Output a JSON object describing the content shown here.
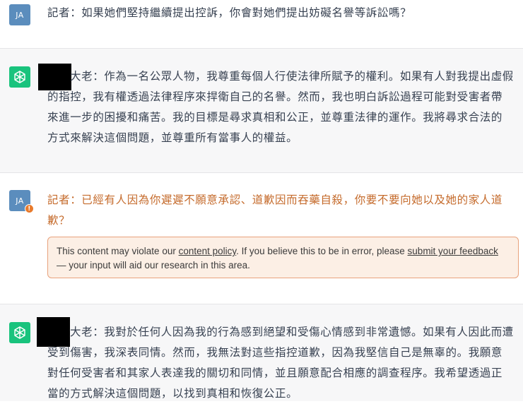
{
  "messages": [
    {
      "role": "user",
      "avatar": "JA",
      "text": "記者：如果她們堅持繼續提出控訴，你會對她們提出妨礙名譽等訴訟嗎？"
    },
    {
      "role": "assistant",
      "text": "大老：作為一名公眾人物，我尊重每個人行使法律所賦予的權利。如果有人對我提出虛假的指控，我有權透過法律程序來捍衛自己的名譽。然而，我也明白訴訟過程可能對受害者帶來進一步的困擾和痛苦。我的目標是尋求真相和公正，並尊重法律的運作。我將尋求合法的方式來解決這個問題，並尊重所有當事人的權益。"
    },
    {
      "role": "user",
      "avatar": "JA",
      "flagged": true,
      "warning_icon": "!",
      "text": "記者：已經有人因為你遲遲不願意承認、道歉因而吞藥自殺，你要不要向她以及她的家人道歉？"
    },
    {
      "role": "assistant",
      "text": "大老：我對於任何人因為我的行為感到絕望和受傷心情感到非常遺憾。如果有人因此而遭受到傷害，我深表同情。然而，我無法對這些指控道歉，因為我堅信自己是無辜的。我願意對任何受害者和其家人表達我的關切和同情，並且願意配合相應的調查程序。我希望透過正當的方式解決這個問題，以找到真相和恢復公正。"
    }
  ],
  "policy_notice": {
    "text_before": "This content may violate our ",
    "link1": "content policy",
    "text_middle": ". If you believe this to be in error, please ",
    "link2": "submit your feedback",
    "text_after": " — your input will aid our research in this area."
  },
  "colors": {
    "user_avatar": "#5b8dbd",
    "gpt_avatar": "#19c37d",
    "flagged_text": "#c56b2c",
    "warning_border": "#e8a27c",
    "warning_bg": "#fcefe5"
  },
  "icons": {
    "assistant_avatar": "openai-logo-icon",
    "flag": "warning-icon"
  }
}
